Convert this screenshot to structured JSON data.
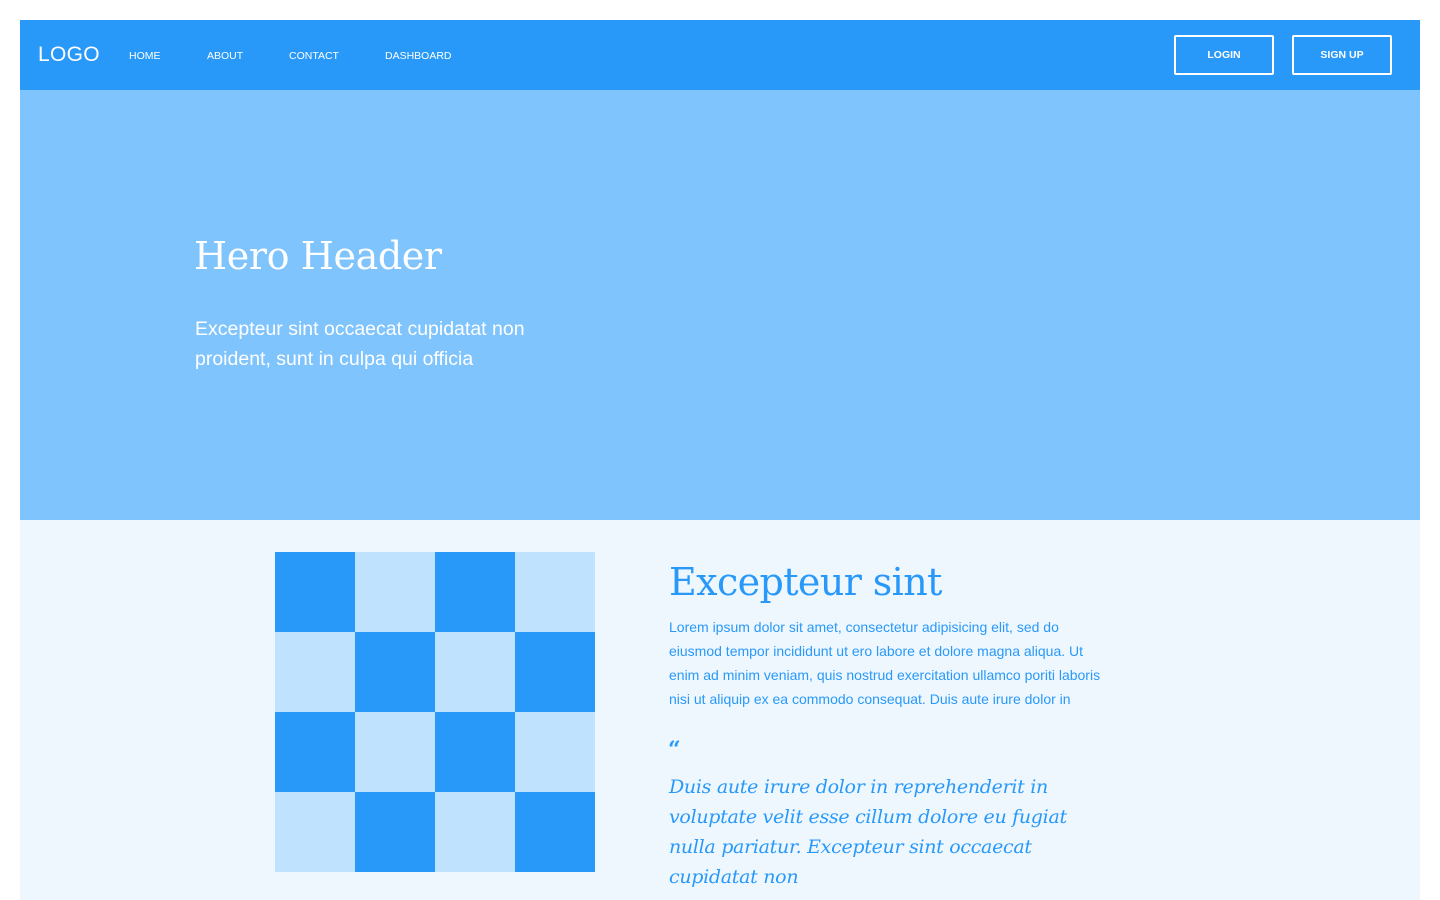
{
  "nav": {
    "logo": "LOGO",
    "links": [
      "HOME",
      "ABOUT",
      "CONTACT",
      "DASHBOARD"
    ],
    "login_label": "LOGIN",
    "signup_label": "SIGN UP"
  },
  "hero": {
    "title": "Hero Header",
    "subtitle": "Excepteur sint occaecat cupidatat non proident, sunt in culpa qui officia"
  },
  "feature": {
    "title": "Excepteur sint",
    "body": "Lorem ipsum dolor sit amet, consectetur adipisicing elit, sed do eiusmod tempor incididunt ut ero labore et dolore magna aliqua. Ut enim ad minim veniam, quis nostrud exercitation ullamco poriti laboris nisi ut aliquip ex ea commodo consequat. Duis aute irure dolor in",
    "quote_mark": "“",
    "quote": "Duis aute irure dolor in reprehenderit in voluptate velit esse cillum dolore eu fugiat nulla pariatur. Excepteur sint occaecat cupidatat non",
    "checker_pattern": [
      [
        "dark",
        "light",
        "dark",
        "light"
      ],
      [
        "light",
        "dark",
        "light",
        "dark"
      ],
      [
        "dark",
        "light",
        "dark",
        "light"
      ],
      [
        "light",
        "dark",
        "light",
        "dark"
      ]
    ]
  },
  "colors": {
    "primary": "#2899f9",
    "hero_bg": "#7fc4fd",
    "section_bg": "#eff7fe",
    "tile_light": "#bfe2fe",
    "text_on_primary": "#ffffff"
  }
}
